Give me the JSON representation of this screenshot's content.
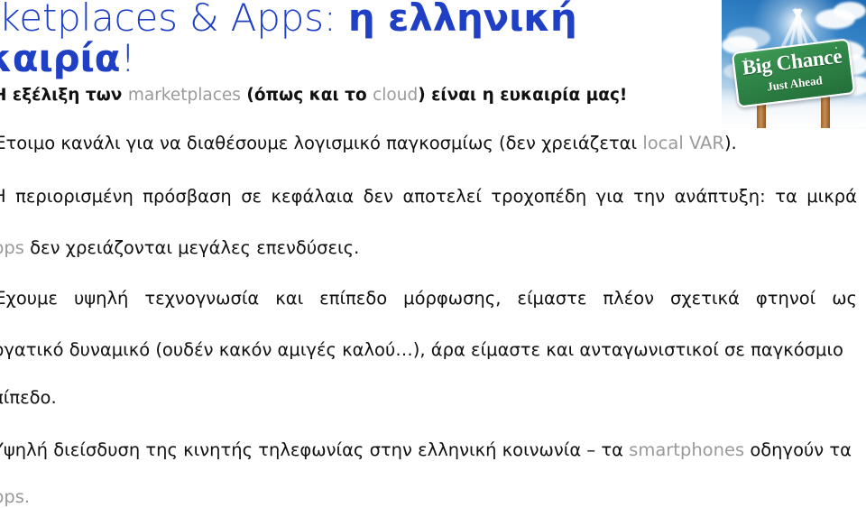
{
  "slide": {
    "title": {
      "line1_light": "arketplaces & Apps: ",
      "line1_bold": "η ελληνική",
      "line2_bold": "υκαιρία",
      "line2_light": "!"
    },
    "photo": {
      "alt_name": "big-chance-road-sign-photo",
      "sign_main_text": "Big Chance",
      "sign_sub_text": "Just Ahead",
      "sign_color": "#2f8447",
      "sky_color": "#1d6ab4"
    },
    "body": [
      {
        "id": "bullet-1",
        "runs": [
          {
            "text": "Η εξέλιξη των ",
            "style": "bold"
          },
          {
            "text": "marketplaces",
            "style": "latin"
          },
          {
            "text": " (όπως και το ",
            "style": "bold"
          },
          {
            "text": "cloud",
            "style": "latin"
          },
          {
            "text": ") είναι η ευκαιρία μας!",
            "style": "bold"
          }
        ]
      },
      {
        "id": "bullet-2",
        "runs": [
          {
            "text": "Έτοιμο κανάλι για να διαθέσουμε λογισμικό παγκοσμίως (δεν χρειάζεται ",
            "style": "normal"
          },
          {
            "text": "local VAR",
            "style": "latin"
          },
          {
            "text": ").",
            "style": "normal"
          }
        ]
      },
      {
        "id": "bullet-3-line-1",
        "runs": [
          {
            "text": "Η περιορισμένη πρόσβαση σε κεφάλαια δεν αποτελεί τροχοπέδη για την ανάπτυξη: τα μικρά",
            "style": "normal"
          }
        ]
      },
      {
        "id": "bullet-3-line-2",
        "runs": [
          {
            "text": "pps",
            "style": "latin"
          },
          {
            "text": " δεν χρειάζονται μεγάλες επενδύσεις.",
            "style": "normal"
          }
        ]
      },
      {
        "id": "bullet-4-line-1",
        "runs": [
          {
            "text": "Έχουμε υψηλή τεχνογνωσία και επίπεδο μόρφωσης, είμαστε πλέον σχετικά φτηνοί ως",
            "style": "normal"
          }
        ]
      },
      {
        "id": "bullet-4-line-2",
        "runs": [
          {
            "text": "ργατικό δυναμικό (ουδέν κακόν αμιγές καλού…), άρα είμαστε και ανταγωνιστικοί σε παγκόσμιο",
            "style": "normal"
          }
        ]
      },
      {
        "id": "bullet-4-line-3",
        "runs": [
          {
            "text": "πίπεδο.",
            "style": "normal"
          }
        ]
      },
      {
        "id": "bullet-5-line-1",
        "runs": [
          {
            "text": "Υψηλή διείσδυση της κινητής τηλεφωνίας στην ελληνική κοινωνία – τα ",
            "style": "normal"
          },
          {
            "text": "smartphones",
            "style": "latin"
          },
          {
            "text": " οδηγούν τα",
            "style": "normal"
          }
        ]
      },
      {
        "id": "bullet-5-line-2",
        "runs": [
          {
            "text": "pps.",
            "style": "latin"
          }
        ]
      }
    ],
    "colors": {
      "title_blue": "#1f40c4",
      "body_black": "#111111",
      "latin_gray": "#9a9a9a",
      "background": "#ffffff"
    }
  }
}
